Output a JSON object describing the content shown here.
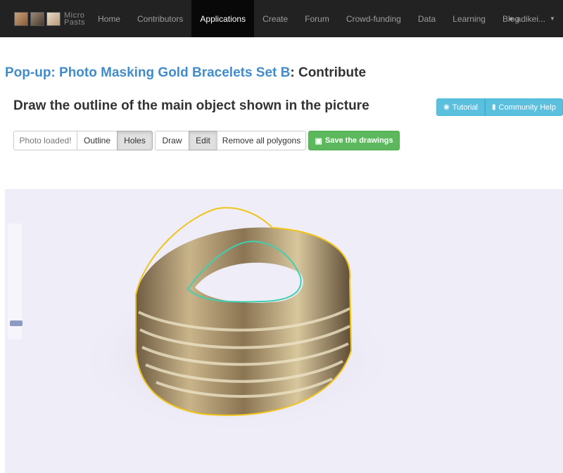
{
  "brand": {
    "line1": "Micro",
    "line2": "Pasts"
  },
  "nav": {
    "items": [
      "Home",
      "Contributors",
      "Applications",
      "Create",
      "Forum",
      "Crowd-funding",
      "Data",
      "Learning",
      "Blog"
    ],
    "active": "Applications",
    "user": "adikei...",
    "icons": {
      "user": "person-icon",
      "dropdown": "caret-down-icon"
    }
  },
  "page": {
    "title_link": "Pop-up: Photo Masking Gold Bracelets Set B",
    "title_suffix": ": Contribute",
    "subtitle": "Draw the outline of the main object shown in the picture"
  },
  "help": {
    "tutorial": "Tutorial",
    "community": "Community Help",
    "icons": {
      "tutorial": "eye-icon",
      "community": "book-icon"
    }
  },
  "toolbar": {
    "status": "Photo loaded!",
    "outline": "Outline",
    "holes": "Holes",
    "draw": "Draw",
    "edit": "Edit",
    "remove": "Remove all polygons",
    "save": "Save the drawings",
    "save_icon": "floppy-disk-icon"
  },
  "colors": {
    "navbar": "#222222",
    "link": "#428bca",
    "info": "#5bc0de",
    "success": "#5cb85c",
    "outline_polygon": "#f0c419",
    "hole_polygon": "#3fd0b0",
    "canvas_bg": "#efedf7"
  }
}
